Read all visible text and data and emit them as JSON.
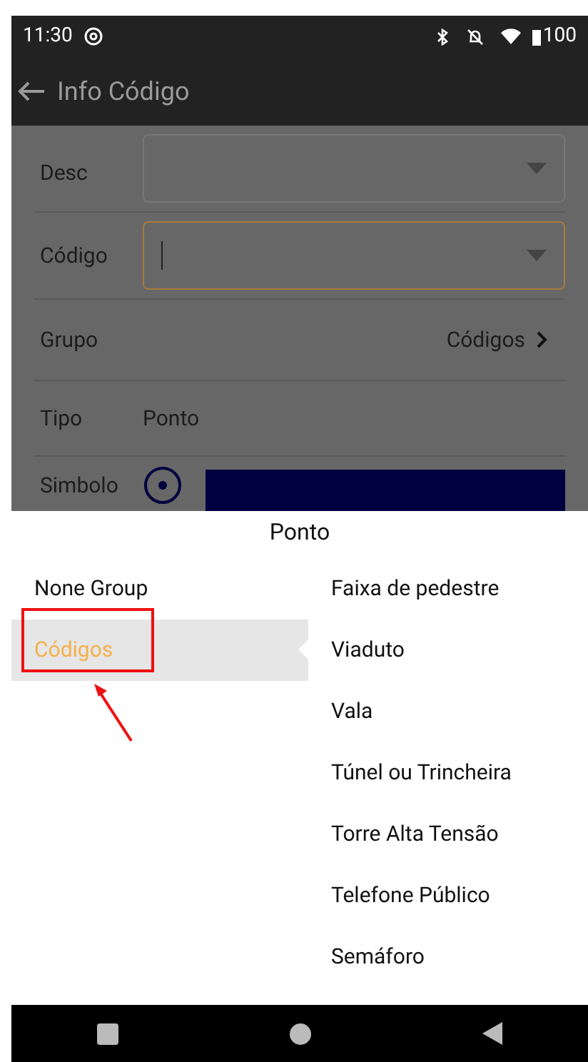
{
  "status_bar": {
    "time": "11:30",
    "battery": "100"
  },
  "app_bar": {
    "title": "Info Código"
  },
  "form": {
    "desc": {
      "label": "Desc"
    },
    "codigo": {
      "label": "Código"
    },
    "grupo": {
      "label": "Grupo",
      "value": "Códigos"
    },
    "tipo": {
      "label": "Tipo",
      "value": "Ponto"
    },
    "simbolo": {
      "label": "Simbolo",
      "color": "#000040"
    }
  },
  "sheet": {
    "title": "Ponto",
    "groups": [
      {
        "label": "None Group",
        "selected": false
      },
      {
        "label": "Códigos",
        "selected": true
      }
    ],
    "codes": [
      "Faixa de pedestre",
      "Viaduto",
      "Vala",
      "Túnel ou Trincheira",
      "Torre Alta Tensão",
      "Telefone Público",
      "Semáforo"
    ]
  }
}
